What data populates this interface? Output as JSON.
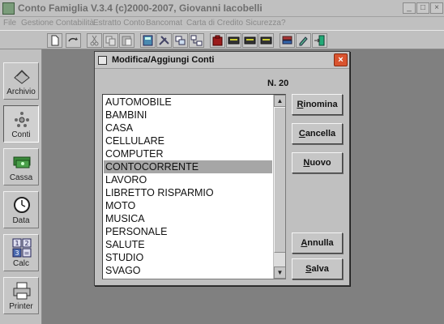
{
  "window": {
    "title": "Conto Famiglia  V.3.4 (c)2000-2007, Giovanni Iacobelli",
    "minimize": "_",
    "maximize": "□",
    "close": "×"
  },
  "menu": {
    "items": [
      "File",
      "Gestione Contabilità",
      "Estratto Conto",
      "Bancomat",
      "Carta di Credito",
      "Sicurezza",
      "?"
    ]
  },
  "toolbar": {
    "buttons": [
      "new-doc-icon",
      "open-arrow-icon",
      "cut-icon",
      "copy-icon",
      "paste-icon",
      "calculator-icon",
      "tools-icon",
      "copy-window-icon",
      "network-icon",
      "safe-icon",
      "card-icon",
      "card2-icon",
      "card3-icon",
      "books-icon",
      "edit-icon",
      "exit-icon"
    ]
  },
  "sidebar": {
    "items": [
      {
        "label": "Archivio",
        "icon": "archive-icon"
      },
      {
        "label": "Conti",
        "icon": "accounts-icon"
      },
      {
        "label": "Cassa",
        "icon": "cash-icon"
      },
      {
        "label": "Data",
        "icon": "clock-icon"
      },
      {
        "label": "Calc",
        "icon": "calculator-icon"
      },
      {
        "label": "Printer",
        "icon": "printer-icon"
      }
    ],
    "active": "Conti"
  },
  "dialog": {
    "title": "Modifica/Aggiungi Conti",
    "close": "×",
    "count_label": "N. 20",
    "accounts": [
      "AUTOMOBILE",
      "BAMBINI",
      "CASA",
      "CELLULARE",
      "COMPUTER",
      "CONTOCORRENTE",
      "LAVORO",
      "LIBRETTO RISPARMIO",
      "MOTO",
      "MUSICA",
      "PERSONALE",
      "SALUTE",
      "STUDIO",
      "SVAGO"
    ],
    "selected": "CONTOCORRENTE",
    "scroll_up": "▲",
    "scroll_down": "▼",
    "buttons": {
      "rename": {
        "mnemonic": "R",
        "rest": "inomina"
      },
      "delete": {
        "mnemonic": "C",
        "rest": "ancella"
      },
      "new": {
        "mnemonic": "N",
        "rest": "uovo"
      },
      "cancel": {
        "mnemonic": "A",
        "rest": "nnulla"
      },
      "save": {
        "mnemonic": "S",
        "rest": "alva"
      }
    }
  }
}
